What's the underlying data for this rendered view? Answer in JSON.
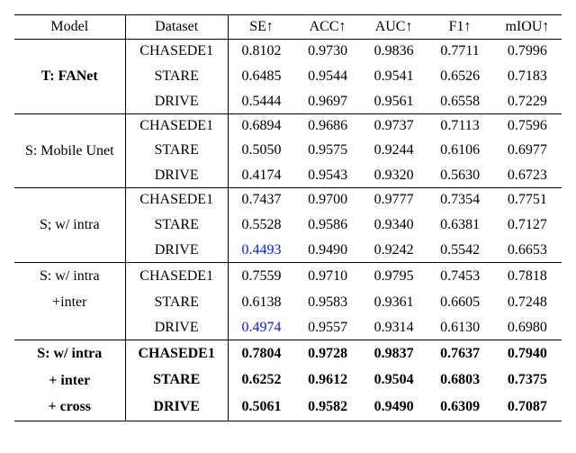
{
  "chart_data": {
    "type": "table",
    "columns": [
      "Model",
      "Dataset",
      "SE↑",
      "ACC↑",
      "AUC↑",
      "F1↑",
      "mIOU↑"
    ],
    "groups": [
      {
        "model_lines": [
          "",
          "T: FANet",
          ""
        ],
        "bold_model_idx": [
          1
        ],
        "rows": [
          {
            "dataset": "CHASEDE1",
            "SE": "0.8102",
            "ACC": "0.9730",
            "AUC": "0.9836",
            "F1": "0.7711",
            "mIOU": "0.7996"
          },
          {
            "dataset": "STARE",
            "SE": "0.6485",
            "ACC": "0.9544",
            "AUC": "0.9541",
            "F1": "0.6526",
            "mIOU": "0.7183"
          },
          {
            "dataset": "DRIVE",
            "SE": "0.5444",
            "ACC": "0.9697",
            "AUC": "0.9561",
            "F1": "0.6558",
            "mIOU": "0.7229"
          }
        ]
      },
      {
        "model_lines": [
          "",
          "S: Mobile Unet",
          ""
        ],
        "rows": [
          {
            "dataset": "CHASEDE1",
            "SE": "0.6894",
            "ACC": "0.9686",
            "AUC": "0.9737",
            "F1": "0.7113",
            "mIOU": "0.7596"
          },
          {
            "dataset": "STARE",
            "SE": "0.5050",
            "ACC": "0.9575",
            "AUC": "0.9244",
            "F1": "0.6106",
            "mIOU": "0.6977"
          },
          {
            "dataset": "DRIVE",
            "SE": "0.4174",
            "ACC": "0.9543",
            "AUC": "0.9320",
            "F1": "0.5630",
            "mIOU": "0.6723"
          }
        ]
      },
      {
        "model_lines": [
          "",
          "S; w/ intra",
          ""
        ],
        "rows": [
          {
            "dataset": "CHASEDE1",
            "SE": "0.7437",
            "ACC": "0.9700",
            "AUC": "0.9777",
            "F1": "0.7354",
            "mIOU": "0.7751"
          },
          {
            "dataset": "STARE",
            "SE": "0.5528",
            "ACC": "0.9586",
            "AUC": "0.9340",
            "F1": "0.6381",
            "mIOU": "0.7127"
          },
          {
            "dataset": "DRIVE",
            "SE": "0.4493",
            "SE_blue": true,
            "ACC": "0.9490",
            "AUC": "0.9242",
            "F1": "0.5542",
            "mIOU": "0.6653"
          }
        ]
      },
      {
        "model_lines": [
          "S: w/ intra",
          "+inter",
          ""
        ],
        "model_align": [
          "",
          "",
          ""
        ],
        "rows": [
          {
            "dataset": "CHASEDE1",
            "SE": "0.7559",
            "ACC": "0.9710",
            "AUC": "0.9795",
            "F1": "0.7453",
            "mIOU": "0.7818"
          },
          {
            "dataset": "STARE",
            "SE": "0.6138",
            "ACC": "0.9583",
            "AUC": "0.9361",
            "F1": "0.6605",
            "mIOU": "0.7248"
          },
          {
            "dataset": "DRIVE",
            "SE": "0.4974",
            "SE_blue": true,
            "ACC": "0.9557",
            "AUC": "0.9314",
            "F1": "0.6130",
            "mIOU": "0.6980"
          }
        ]
      },
      {
        "model_lines": [
          "S: w/ intra",
          "+ inter",
          "+ cross"
        ],
        "bold_model_idx": [
          0,
          1,
          2
        ],
        "bold_rows": true,
        "rows": [
          {
            "dataset": "CHASEDE1",
            "SE": "0.7804",
            "ACC": "0.9728",
            "AUC": "0.9837",
            "F1": "0.7637",
            "mIOU": "0.7940"
          },
          {
            "dataset": "STARE",
            "SE": "0.6252",
            "ACC": "0.9612",
            "AUC": "0.9504",
            "F1": "0.6803",
            "mIOU": "0.7375"
          },
          {
            "dataset": "DRIVE",
            "SE": "0.5061",
            "ACC": "0.9582",
            "AUC": "0.9490",
            "F1": "0.6309",
            "mIOU": "0.7087"
          }
        ]
      }
    ]
  }
}
